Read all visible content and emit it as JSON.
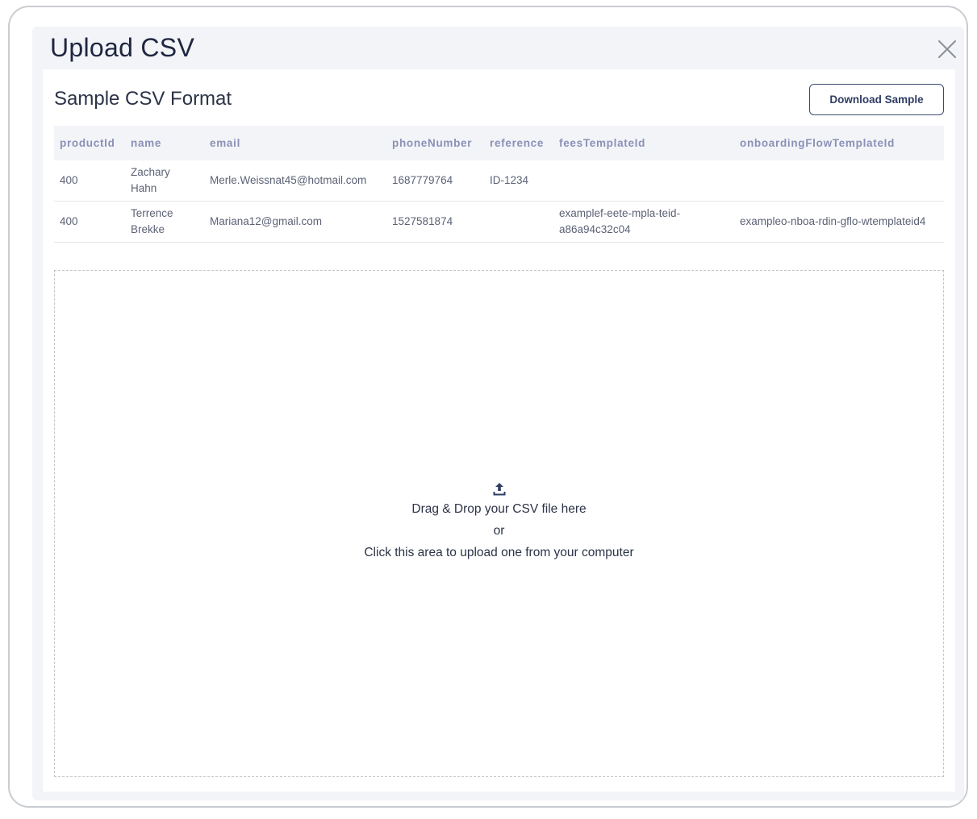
{
  "modal": {
    "title": "Upload CSV",
    "close_icon": "close-icon"
  },
  "sample": {
    "title": "Sample CSV Format",
    "download_label": "Download Sample",
    "columns": [
      "productId",
      "name",
      "email",
      "phoneNumber",
      "reference",
      "feesTemplateId",
      "onboardingFlowTemplateId"
    ],
    "rows": [
      [
        "400",
        "Zachary Hahn",
        "Merle.Weissnat45@hotmail.com",
        "1687779764",
        "ID-1234",
        "",
        ""
      ],
      [
        "400",
        "Terrence Brekke",
        "Mariana12@gmail.com",
        "1527581874",
        "",
        "examplef-eete-mpla-teid-a86a94c32c04",
        "exampleo-nboa-rdin-gflo-wtemplateid4"
      ]
    ]
  },
  "dropzone": {
    "icon": "upload-icon",
    "line1": "Drag & Drop your CSV file here",
    "line2": "or",
    "line3": "Click this area to upload one from your computer"
  },
  "colors": {
    "header_text": "#8a91b6",
    "button_border": "#3a4a70",
    "modal_bg": "#f3f4f8"
  }
}
